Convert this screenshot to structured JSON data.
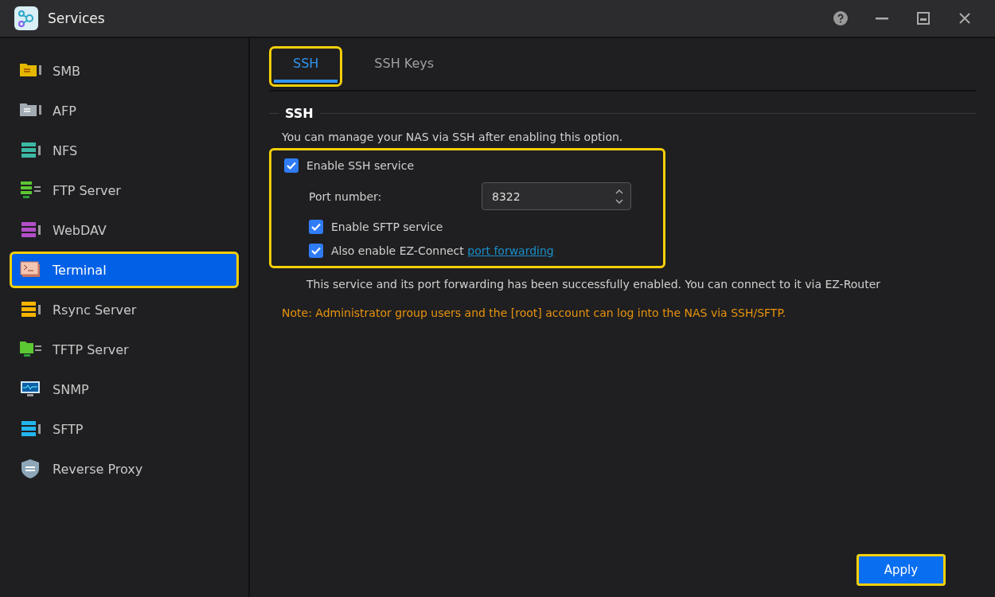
{
  "window": {
    "title": "Services"
  },
  "sidebar": {
    "items": [
      {
        "label": "SMB",
        "selected": false,
        "highlighted": false
      },
      {
        "label": "AFP",
        "selected": false,
        "highlighted": false
      },
      {
        "label": "NFS",
        "selected": false,
        "highlighted": false
      },
      {
        "label": "FTP Server",
        "selected": false,
        "highlighted": false
      },
      {
        "label": "WebDAV",
        "selected": false,
        "highlighted": false
      },
      {
        "label": "Terminal",
        "selected": true,
        "highlighted": true
      },
      {
        "label": "Rsync Server",
        "selected": false,
        "highlighted": false
      },
      {
        "label": "TFTP Server",
        "selected": false,
        "highlighted": false
      },
      {
        "label": "SNMP",
        "selected": false,
        "highlighted": false
      },
      {
        "label": "SFTP",
        "selected": false,
        "highlighted": false
      },
      {
        "label": "Reverse Proxy",
        "selected": false,
        "highlighted": false
      }
    ]
  },
  "tabs": [
    {
      "label": "SSH",
      "selected": true,
      "highlighted": true
    },
    {
      "label": "SSH Keys",
      "selected": false,
      "highlighted": false
    }
  ],
  "section": {
    "title": "SSH",
    "description": "You can manage your NAS via SSH after enabling this option.",
    "options_highlighted": true,
    "enable_ssh": {
      "label": "Enable SSH service",
      "checked": true
    },
    "port": {
      "label": "Port number:",
      "value": "8322"
    },
    "sub_options": [
      {
        "label": "Enable SFTP service",
        "checked": true
      },
      {
        "label": "Also enable EZ-Connect",
        "link": "port forwarding",
        "checked": true
      }
    ],
    "status": "This service and its port forwarding has been successfully enabled. You can connect to it via EZ-Router",
    "note": "Note: Administrator group users and the [root] account can log into the NAS via SSH/SFTP."
  },
  "apply_button": {
    "label": "Apply",
    "highlighted": true
  }
}
